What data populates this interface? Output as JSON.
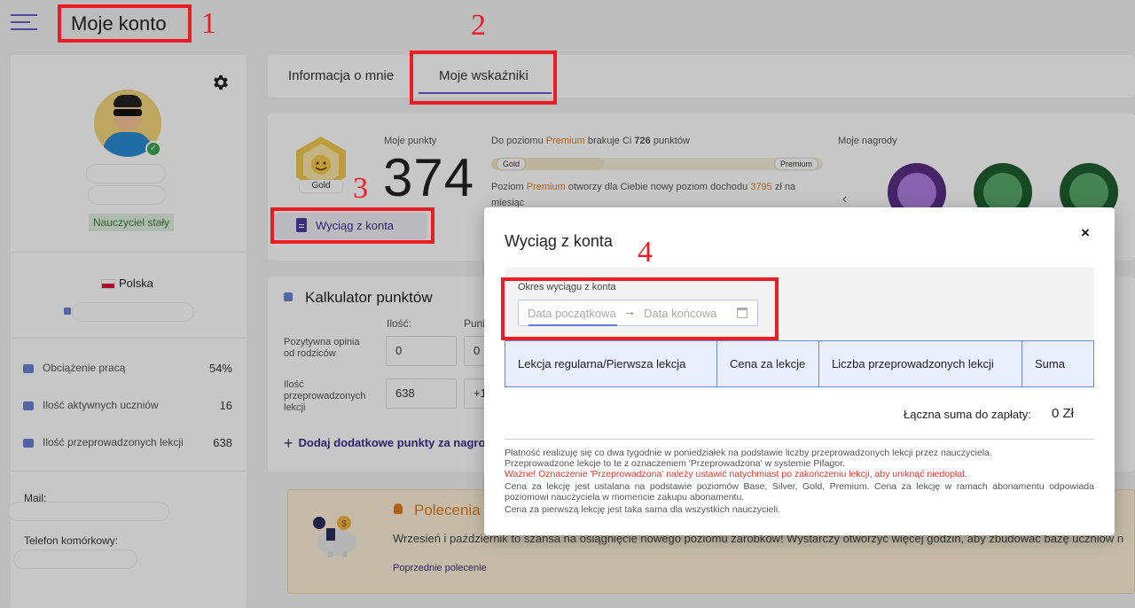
{
  "header": {
    "title": "Moje konto"
  },
  "profile": {
    "role": "Nauczyciel stały",
    "country": "Polska",
    "stats": [
      {
        "label": "Obciążenie pracą",
        "value": "54%"
      },
      {
        "label": "Ilość aktywnych uczniów",
        "value": "16"
      },
      {
        "label": "Ilość przeprowadzonych lekcji",
        "value": "638"
      }
    ],
    "mail_label": "Mail:",
    "phone_label": "Telefon komórkowy:"
  },
  "tabs": [
    {
      "label": "Informacja o mnie"
    },
    {
      "label": "Moje wskaźniki"
    }
  ],
  "points": {
    "badge_level": "Gold",
    "label": "Moje punkty",
    "value": "374",
    "progress_text_a": "Do poziomu ",
    "progress_text_level": "Premium",
    "progress_text_b": " brakuje Ci ",
    "progress_text_points": "726",
    "progress_text_c": " punktów",
    "progress_from": "Gold",
    "progress_to": "Premium",
    "progress_fraction": 0.34,
    "level_text_a": "Poziom ",
    "level_text_level": "Premium",
    "level_text_b": " otworzy dla Ciebie nowy poziom dochodu ",
    "level_text_amount": "3795",
    "level_text_c": " zł na",
    "level_text_d": "miesiąc",
    "statement_button": "Wyciąg z konta",
    "rewards_label": "Moje nagrody"
  },
  "calculator": {
    "title": "Kalkulator punktów",
    "col_qty": "Ilość:",
    "col_points": "Punk",
    "rows": [
      {
        "label": "Pozytywna opinia od rodziców",
        "qty": "0",
        "points": "0"
      },
      {
        "label": "Ilość przeprowadzonych lekcji",
        "qty": "638",
        "points": "+1"
      }
    ],
    "add_link": "Dodaj dodatkowe punkty za nagro"
  },
  "referral": {
    "title": "Polecenia",
    "text": "Wrzesień i październik to szansa na osiągnięcie nowego poziomu zarobków! Wystarczy otworzyć więcej godzin, aby zbudować bazę uczniów n",
    "link": "Poprzednie polecenie"
  },
  "modal": {
    "title": "Wyciąg z konta",
    "close": "×",
    "period_label": "Okres wyciągu z konta",
    "date_start_placeholder": "Data początkowa",
    "date_arrow": "→",
    "date_end_placeholder": "Data końcowa",
    "table_headers": [
      "Lekcja regularna/Pierwsza lekcja",
      "Cena za lekcje",
      "Liczba przeprowadzonych lekcji",
      "Suma"
    ],
    "total_label": "Łączna suma do zapłaty:",
    "total_value": "0 Zł",
    "notes": [
      {
        "text": "Płatność realizuję się co dwa tygodnie w poniedziałek na podstawie liczby przeprowadzonych lekcji przez nauczyciela.",
        "style": "normal"
      },
      {
        "text": "Przeprowadzone lekcje to te z oznaczeniem 'Przeprowadzona' w systemie Pifagor.",
        "style": "normal"
      },
      {
        "text": "Ważne! Oznaczenie 'Przeprowadzona' należy ustawić natychmiast po zakończeniu lekcji, aby uniknąć niedopłat.",
        "style": "red"
      },
      {
        "text": "Cena za lekcję jest ustalana na podstawie poziomów Base, Silver, Gold, Premium. Cena za lekcję w ramach abonamentu odpowiada poziomowi nauczyciela w momencie zakupu abonamentu.",
        "style": "normal"
      },
      {
        "text": "Cena za pierwszą lekcję jest taka sama dla wszystkich nauczycieli.",
        "style": "normal"
      }
    ]
  },
  "annotations": [
    "1",
    "2",
    "3",
    "4"
  ],
  "colors": {
    "accent": "#6b5fc7",
    "annotation": "#ec1c24",
    "premium": "#e07b1e",
    "table_header": "#e9eefc"
  }
}
